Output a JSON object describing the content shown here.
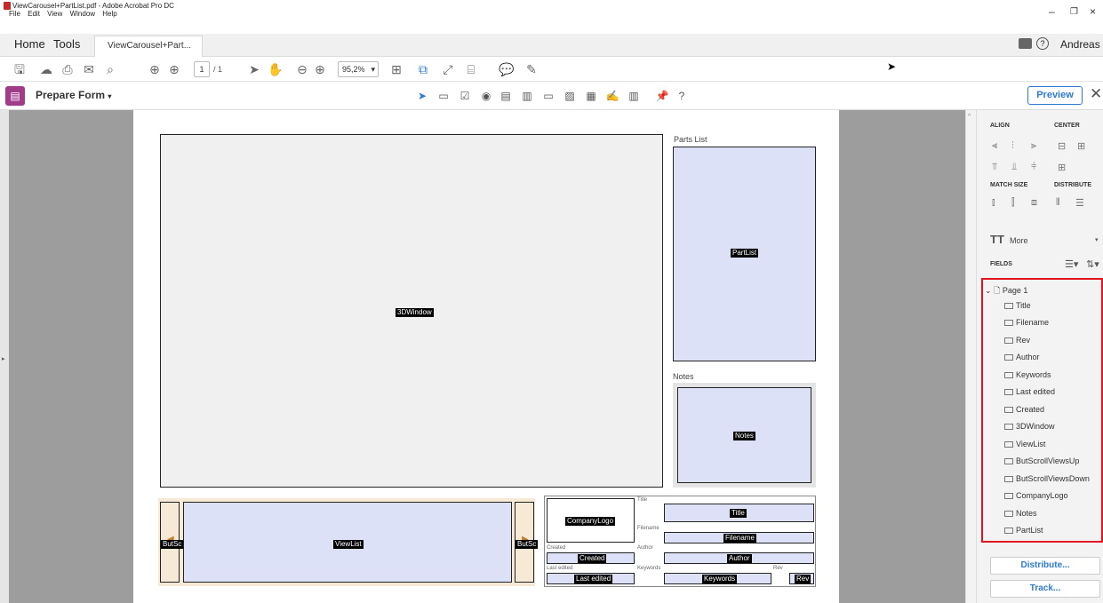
{
  "window": {
    "title": "ViewCarousel+PartList.pdf - Adobe Acrobat Pro DC",
    "menu": [
      "File",
      "Edit",
      "View",
      "Window",
      "Help"
    ]
  },
  "tabs": {
    "home": "Home",
    "tools": "Tools",
    "document": "ViewCarousel+Part...",
    "close": "×",
    "user": "Andreas"
  },
  "toolbar": {
    "page_current": "1",
    "page_total": "/ 1",
    "zoom": "95,2%"
  },
  "prepare_form": {
    "title": "Prepare Form",
    "preview": "Preview"
  },
  "page": {
    "parts_list_heading": "Parts List",
    "notes_heading": "Notes",
    "fields": {
      "window3d": "3DWindow",
      "partlist": "PartList",
      "notes": "Notes",
      "viewlist": "ViewList",
      "butscroll_left": "ButSc",
      "butscroll_right": "ButSc",
      "companylogo": "CompanyLogo",
      "title": "Title",
      "filename": "Filename",
      "created": "Created",
      "author": "Author",
      "last_edited": "Last edited",
      "keywords": "Keywords",
      "rev": "Rev"
    },
    "labels": {
      "title": "Title",
      "filename": "Filename",
      "created": "Created",
      "author": "Author",
      "last_edited": "Last edited",
      "keywords": "Keywords",
      "rev": "Rev"
    }
  },
  "panel": {
    "align": "ALIGN",
    "center": "CENTER",
    "match_size": "MATCH SIZE",
    "distribute": "DISTRIBUTE",
    "more": "More",
    "fields": "FIELDS",
    "page": "Page 1",
    "items": [
      "Title",
      "Filename",
      "Rev",
      "Author",
      "Keywords",
      "Last edited",
      "Created",
      "3DWindow",
      "ViewList",
      "ButScrollViewsUp",
      "ButScrollViewsDown",
      "CompanyLogo",
      "Notes",
      "PartList"
    ],
    "distribute_button": "Distribute...",
    "track_button": "Track..."
  }
}
